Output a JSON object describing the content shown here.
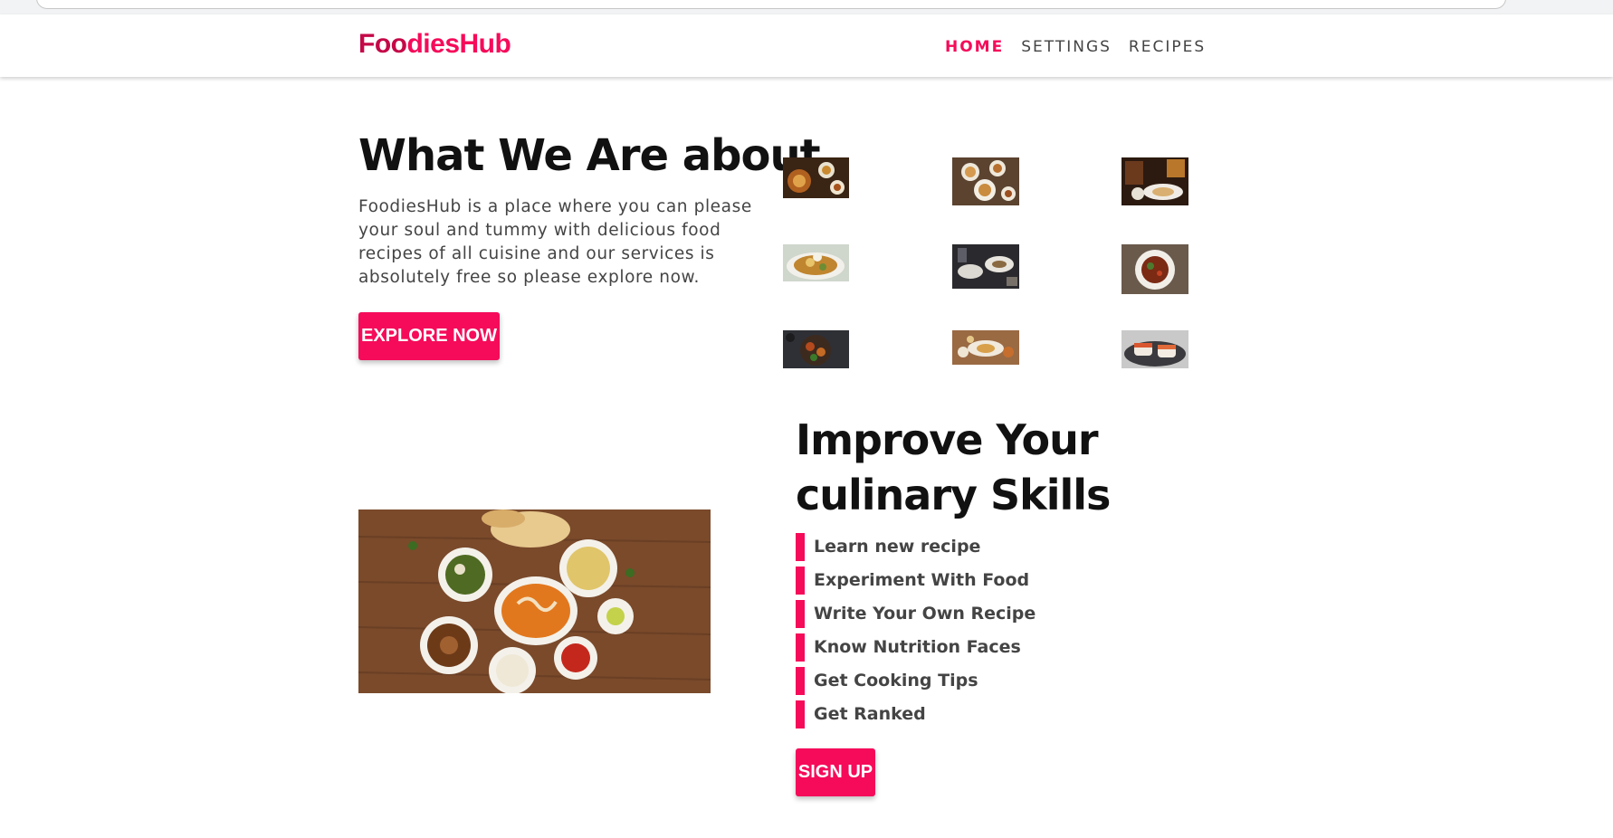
{
  "brand": {
    "logo_part1": "Foo",
    "logo_part2": "diesHub",
    "colors": {
      "accent": "#f50b5a",
      "logo_dark": "#c40848",
      "text": "#444444",
      "heading": "#111111"
    }
  },
  "nav": {
    "items": [
      {
        "label": "HOME",
        "active": true
      },
      {
        "label": "SETTINGS",
        "active": false
      },
      {
        "label": "RECIPES",
        "active": false
      }
    ]
  },
  "hero": {
    "title": "What We Are about",
    "description": "FoodiesHub is a place where you can please your soul and tummy with delicious food recipes of all cuisine and our services is absolutely free so please explore now.",
    "button_label": "EXPLORE NOW"
  },
  "gallery": {
    "icon": "food-photo-icon",
    "images": [
      "food-photo-1",
      "food-photo-2",
      "food-photo-3",
      "food-photo-4",
      "food-photo-5",
      "food-photo-6",
      "food-photo-7",
      "food-photo-8",
      "food-photo-9"
    ]
  },
  "skills": {
    "title_line1": "Improve Your",
    "title_line2": "culinary Skills",
    "items": [
      "Learn new recipe",
      "Experiment With Food",
      "Write Your Own Recipe",
      "Know Nutrition Faces",
      "Get Cooking Tips",
      "Get Ranked"
    ],
    "button_label": "SIGN UP"
  }
}
